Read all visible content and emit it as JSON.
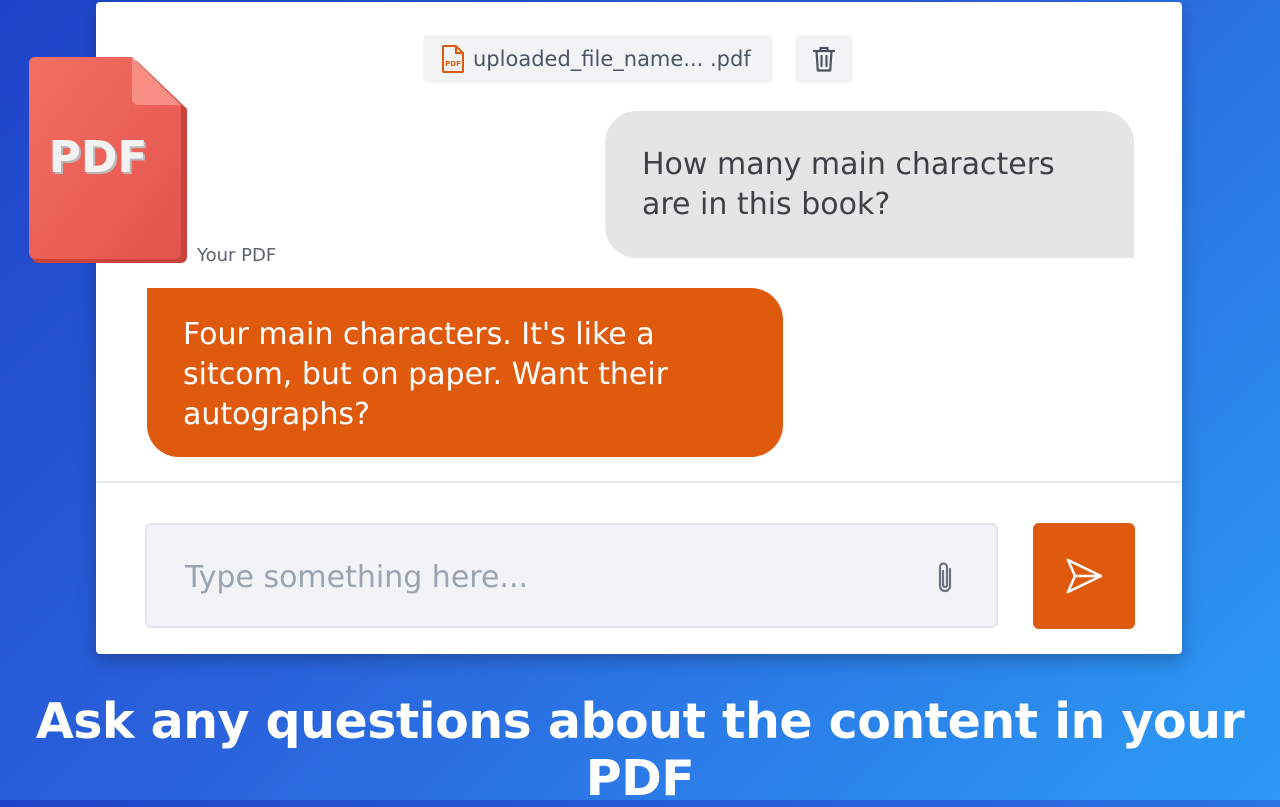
{
  "file_chip": {
    "file_name": "uploaded_file_name... .pdf",
    "icon": "pdf-file-icon",
    "icon_label": "PDF"
  },
  "delete_button": {
    "icon": "trash-icon"
  },
  "messages": [
    {
      "role": "user",
      "text": "How many main characters are in this book?"
    },
    {
      "role": "bot",
      "label": "Your PDF",
      "text": "Four main characters. It's like a sitcom, but on paper. Want their autographs?"
    }
  ],
  "composer": {
    "placeholder": "Type something here...",
    "attach_icon": "paperclip-icon",
    "send_icon": "send-icon"
  },
  "logo": {
    "text": "PDF",
    "icon": "pdf-document-icon"
  },
  "tagline": "Ask any questions about the content in your PDF",
  "colors": {
    "accent": "#e05a0e",
    "user_bubble": "#e5e5e5",
    "background_start": "#1f44c9",
    "background_end": "#2c9bf5"
  }
}
